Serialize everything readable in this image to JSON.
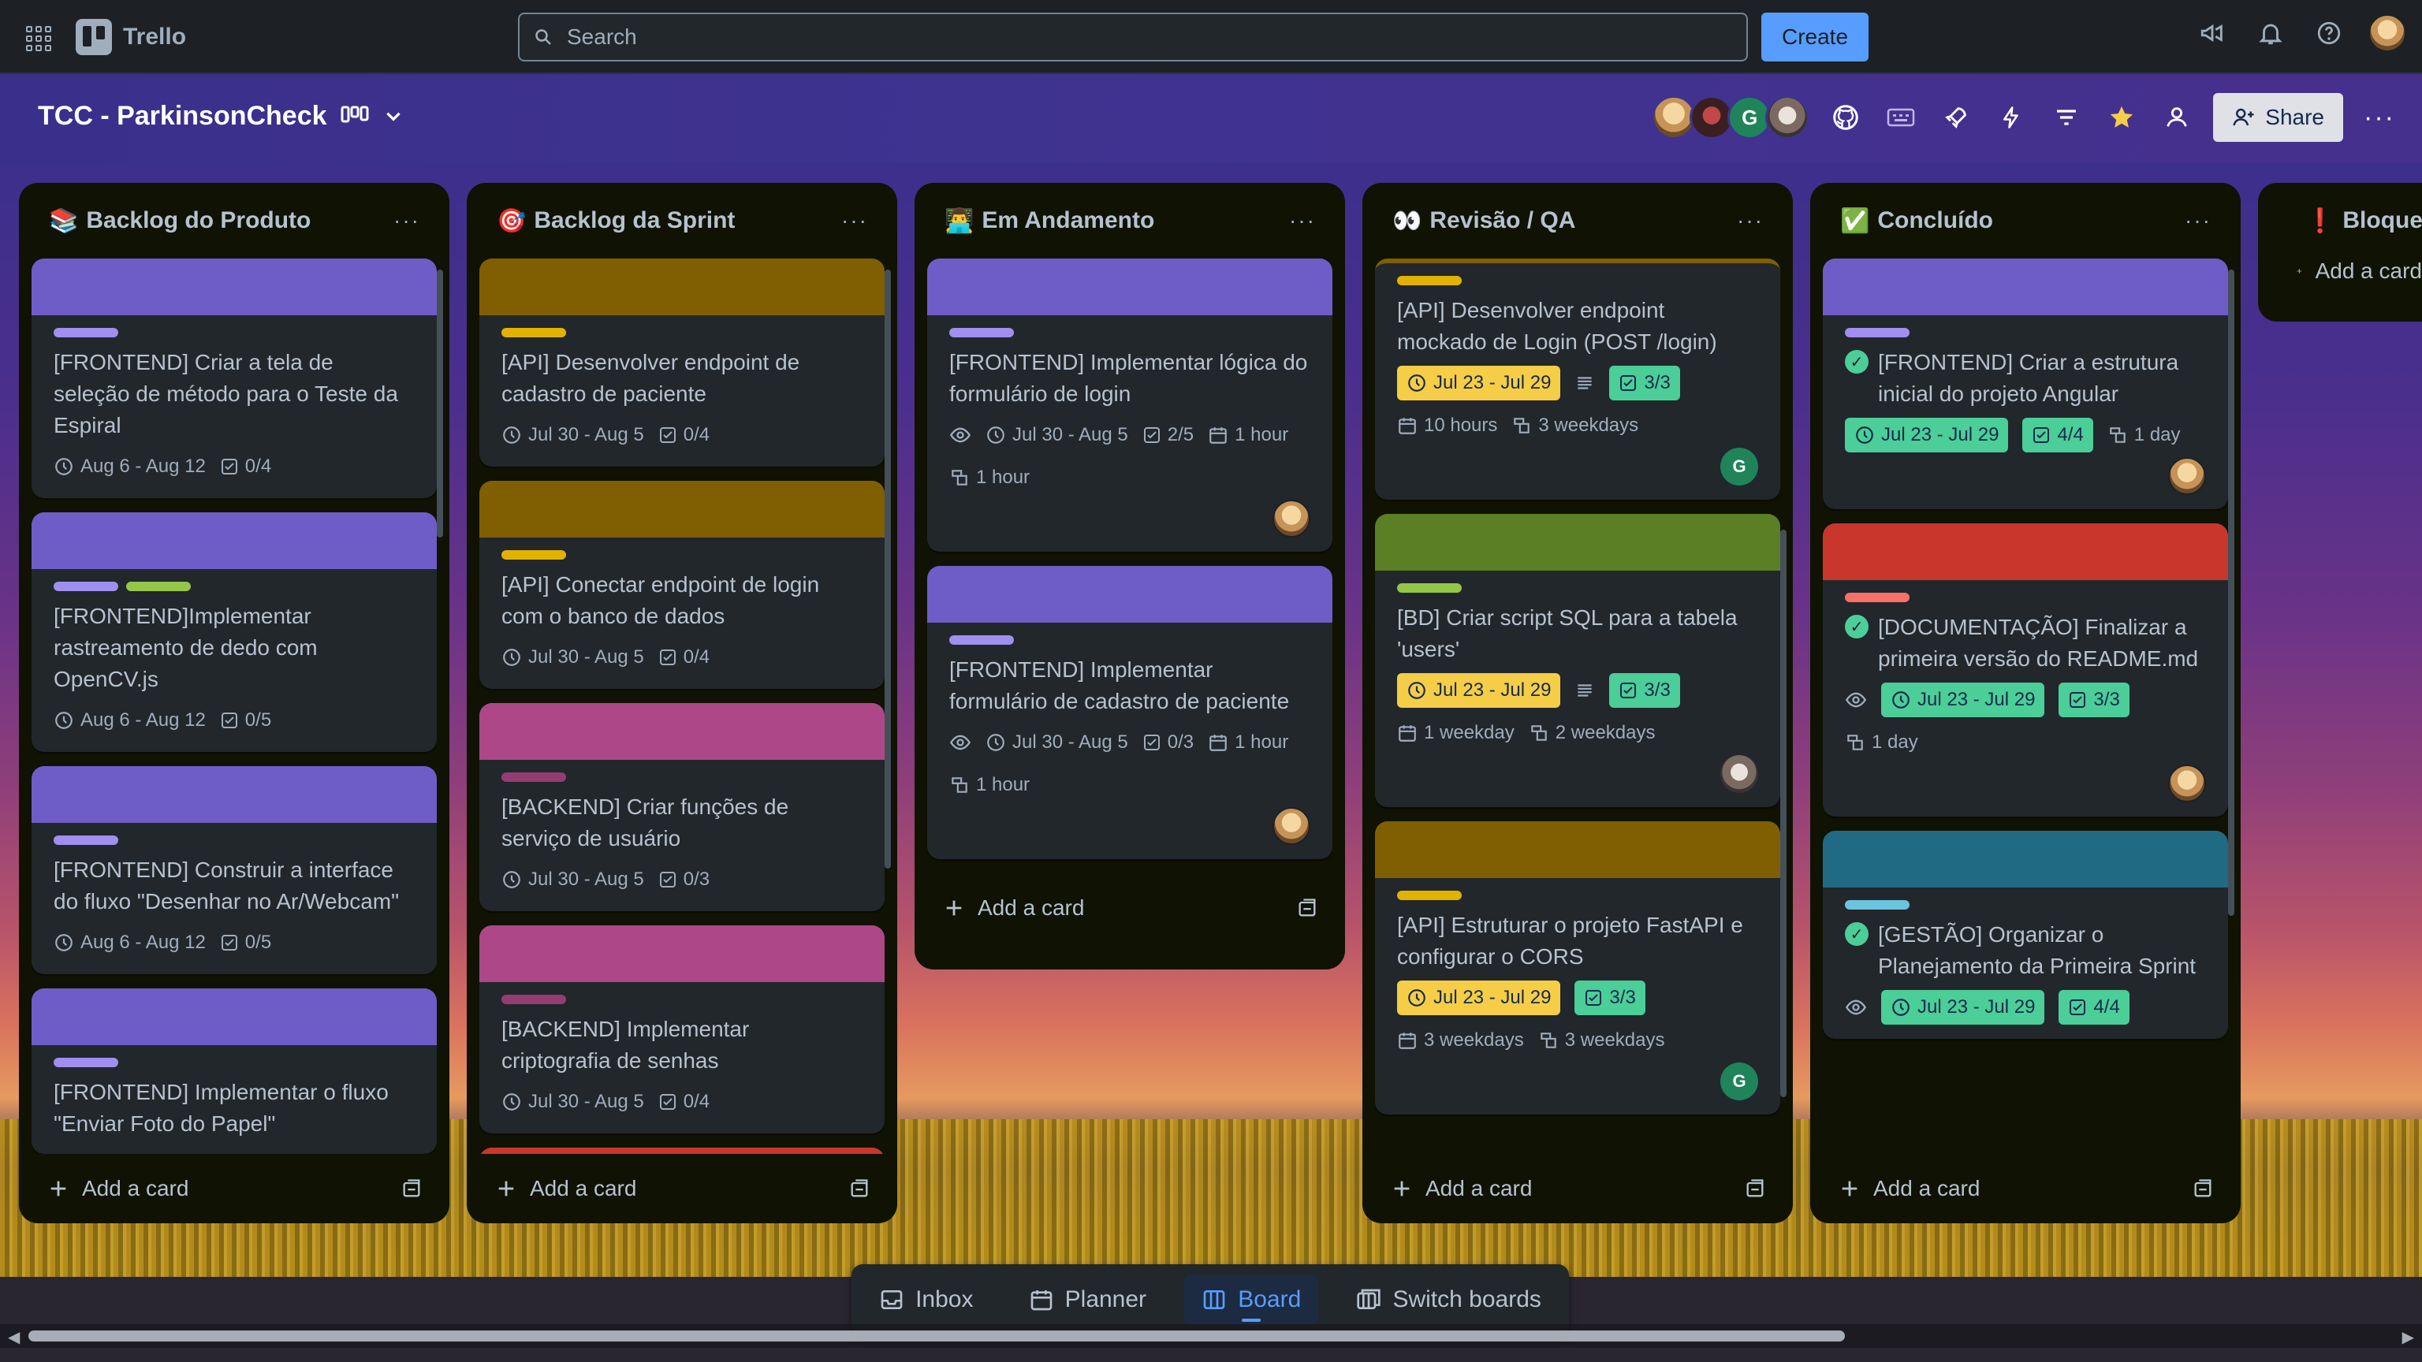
{
  "app": {
    "name": "Trello"
  },
  "topbar": {
    "search_placeholder": "Search",
    "create_label": "Create"
  },
  "board": {
    "title": "TCC - ParkinsonCheck",
    "share_label": "Share",
    "member_g": "G"
  },
  "colors": {
    "purple": "#6e5dc6",
    "olive": "#7f5f01",
    "pink": "#ae4787",
    "red": "#c9372c",
    "teal": "#206a83",
    "green": "#5b7f24",
    "lbl_purple": "#9f8fef",
    "lbl_lime": "#94c748",
    "lbl_olive": "#e2b203",
    "lbl_pink": "#e774bb",
    "lbl_red": "#f87168",
    "lbl_teal": "#6cc3e0",
    "lbl_green": "#94c748"
  },
  "lists": [
    {
      "title": "Backlog do Produto",
      "emoji": "📚",
      "cards": [
        {
          "title": "[FRONTEND] Criar a tela de seleção de método para o Teste da Espiral",
          "dates": "Aug 6 - Aug 12",
          "checklist": "0/4"
        },
        {
          "title": "[FRONTEND]Implementar rastreamento de dedo com OpenCV.js",
          "dates": "Aug 6 - Aug 12",
          "checklist": "0/5"
        },
        {
          "title": "[FRONTEND] Construir a interface do fluxo \"Desenhar no Ar/Webcam\"",
          "dates": "Aug 6 - Aug 12",
          "checklist": "0/5"
        },
        {
          "title": "[FRONTEND] Implementar o fluxo \"Enviar Foto do Papel\""
        }
      ],
      "add_label": "Add a card"
    },
    {
      "title": "Backlog da Sprint",
      "emoji": "🎯",
      "cards": [
        {
          "title": "[API] Desenvolver endpoint de cadastro de paciente",
          "dates": "Jul 30 - Aug 5",
          "checklist": "0/4"
        },
        {
          "title": "[API] Conectar endpoint de login com o banco de dados",
          "dates": "Jul 30 - Aug 5",
          "checklist": "0/4"
        },
        {
          "title": "[BACKEND] Criar funções de serviço de usuário",
          "dates": "Jul 30 - Aug 5",
          "checklist": "0/3"
        },
        {
          "title": "[BACKEND] Implementar criptografia de senhas",
          "dates": "Jul 30 - Aug 5",
          "checklist": "0/4"
        }
      ],
      "add_label": "Add a card"
    },
    {
      "title": "Em Andamento",
      "emoji": "👨‍💻",
      "cards": [
        {
          "title": "[FRONTEND] Implementar lógica do formulário de login",
          "dates": "Jul 30 - Aug 5",
          "checklist": "2/5",
          "estimate": "1 hour",
          "spent": "1 hour"
        },
        {
          "title": "[FRONTEND] Implementar formulário de cadastro de paciente",
          "dates": "Jul 30 - Aug 5",
          "checklist": "0/3",
          "estimate": "1 hour",
          "spent": "1 hour"
        }
      ],
      "add_label": "Add a card"
    },
    {
      "title": "Revisão / QA",
      "emoji": "👀",
      "cards": [
        {
          "title": "[API] Desenvolver endpoint mockado de Login (POST /login)",
          "dates": "Jul 23 - Jul 29",
          "checklist": "3/3",
          "estimate": "10 hours",
          "spent": "3 weekdays"
        },
        {
          "title": "[BD] Criar script SQL para a tabela 'users'",
          "dates": "Jul 23 - Jul 29",
          "checklist": "3/3",
          "estimate": "1 weekday",
          "spent": "2 weekdays"
        },
        {
          "title": "[API] Estruturar o projeto FastAPI e configurar o CORS",
          "dates": "Jul 23 - Jul 29",
          "checklist": "3/3",
          "estimate": "3 weekdays",
          "spent": "3 weekdays"
        }
      ],
      "add_label": "Add a card"
    },
    {
      "title": "Concluído",
      "emoji": "✅",
      "cards": [
        {
          "title": "[FRONTEND] Criar a estrutura inicial do projeto Angular",
          "dates": "Jul 23 - Jul 29",
          "checklist": "4/4",
          "spent": "1 day"
        },
        {
          "title": "[DOCUMENTAÇÃO] Finalizar a primeira versão do README.md",
          "dates": "Jul 23 - Jul 29",
          "checklist": "3/3",
          "spent": "1 day"
        },
        {
          "title": "[GESTÃO] Organizar o Planejamento da Primeira Sprint",
          "dates": "Jul 23 - Jul 29",
          "checklist": "4/4"
        }
      ],
      "add_label": "Add a card"
    },
    {
      "title": "Bloqueado",
      "emoji": "❗",
      "add_label": "Add a card"
    }
  ],
  "switcher": {
    "inbox": "Inbox",
    "planner": "Planner",
    "board": "Board",
    "switch_boards": "Switch boards"
  },
  "icons": [
    "apps-grid-icon",
    "trello-logo-icon",
    "search-icon",
    "megaphone-icon",
    "bell-icon",
    "help-icon",
    "board-view-icon",
    "chevron-down-icon",
    "github-icon",
    "keyboard-icon",
    "rocket-icon",
    "lightning-icon",
    "filter-icon",
    "star-icon",
    "team-icon",
    "add-person-icon",
    "ellipsis-icon",
    "clock-icon",
    "checklist-icon",
    "eye-icon",
    "description-icon",
    "calendar-icon",
    "hourglass-icon",
    "plus-icon",
    "template-icon",
    "inbox-icon",
    "planner-icon",
    "board-icon",
    "switch-boards-icon"
  ]
}
